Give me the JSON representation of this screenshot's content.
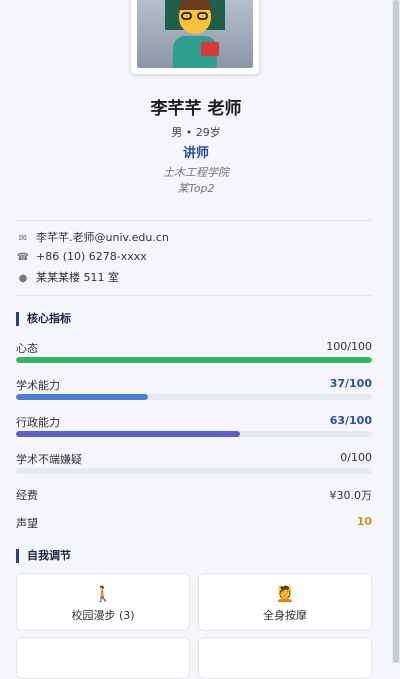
{
  "profile": {
    "name": "李芊芊 老师",
    "meta": "男 • 29岁",
    "title": "讲师",
    "school": "土木工程学院",
    "university": "某Top2",
    "avatar_icon": "teacher-emoji"
  },
  "contact": {
    "email": "李芊芊.老师@univ.edu.cn",
    "phone": "+86 (10) 6278-xxxx",
    "office": "某某某楼 511 室"
  },
  "metrics_section": {
    "title": "核心指标",
    "items": [
      {
        "label": "心态",
        "value_text": "100/100",
        "value": 100,
        "max": 100,
        "color": "#35b865"
      },
      {
        "label": "学术能力",
        "value_text": "37/100",
        "value": 37,
        "max": 100,
        "color": "#4b7fd6"
      },
      {
        "label": "行政能力",
        "value_text": "63/100",
        "value": 63,
        "max": 100,
        "color": "#5b5fc7"
      },
      {
        "label": "学术不端嫌疑",
        "value_text": "0/100",
        "value": 0,
        "max": 100,
        "color": "#9aa3b2"
      }
    ],
    "funds_label": "经费",
    "funds_value": "¥30.0万",
    "reputation_label": "声望",
    "reputation_value": "10"
  },
  "self_section": {
    "title": "自我调节",
    "actions": [
      {
        "label": "校园漫步 (3)",
        "icon": "🚶"
      },
      {
        "label": "全身按摩",
        "icon": "💆"
      }
    ]
  }
}
